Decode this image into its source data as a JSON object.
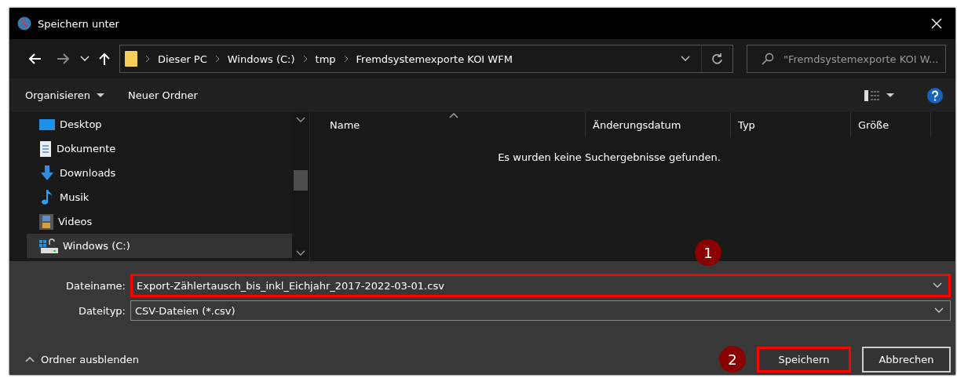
{
  "window": {
    "title": "Speichern unter"
  },
  "breadcrumb": [
    "Dieser PC",
    "Windows (C:)",
    "tmp",
    "Fremdsystemexporte KOI WFM"
  ],
  "search": {
    "placeholder": "\"Fremdsystemexporte KOI W..."
  },
  "toolbar": {
    "organize": "Organisieren",
    "new_folder": "Neuer Ordner"
  },
  "navigation": [
    {
      "label": "Desktop",
      "kind": "desktop",
      "selected": false
    },
    {
      "label": "Dokumente",
      "kind": "documents",
      "selected": false
    },
    {
      "label": "Downloads",
      "kind": "downloads",
      "selected": false
    },
    {
      "label": "Musik",
      "kind": "music",
      "selected": false
    },
    {
      "label": "Videos",
      "kind": "videos",
      "selected": false
    },
    {
      "label": "Windows (C:)",
      "kind": "drive",
      "selected": true
    }
  ],
  "columns": [
    {
      "label": "Name",
      "sorted": true
    },
    {
      "label": "Änderungsdatum",
      "sorted": false
    },
    {
      "label": "Typ",
      "sorted": false
    },
    {
      "label": "Größe",
      "sorted": false
    }
  ],
  "empty_message": "Es wurden keine Suchergebnisse gefunden.",
  "fields": [
    {
      "label": "Dateiname:",
      "value": "Export-Zählertausch_bis_inkl_Eichjahr_2017-2022-03-01.csv",
      "highlighted": true
    },
    {
      "label": "Dateityp:",
      "value": "CSV-Dateien (*.csv)",
      "highlighted": false
    }
  ],
  "hide_folders": "Ordner ausblenden",
  "buttons": [
    {
      "label": "Speichern",
      "highlighted": true
    },
    {
      "label": "Abbrechen",
      "highlighted": false
    }
  ],
  "annotations": [
    "1",
    "2"
  ]
}
